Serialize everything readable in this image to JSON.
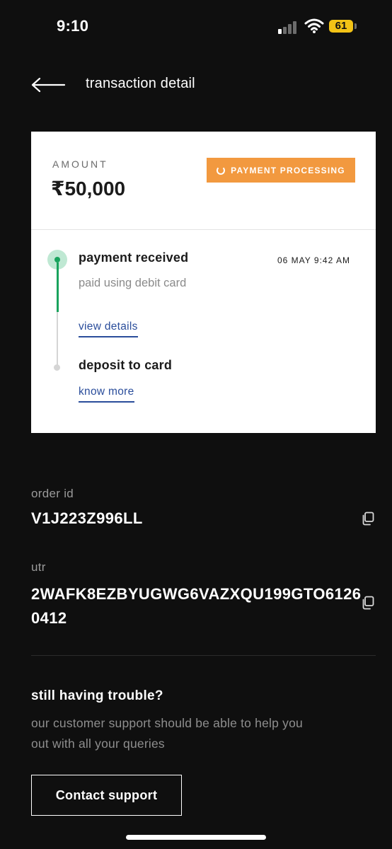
{
  "status_bar": {
    "time": "9:10",
    "battery": "61",
    "icons": [
      "signal-icon",
      "wifi-icon",
      "battery-icon"
    ]
  },
  "header": {
    "title": "transaction detail",
    "back_icon": "arrow-left-icon"
  },
  "card": {
    "amount_label": "AMOUNT",
    "amount_value": "₹50,000",
    "status_badge": "PAYMENT PROCESSING",
    "steps": [
      {
        "title": "payment received",
        "time": "06 MAY 9:42 AM",
        "subtitle": "paid using debit card",
        "link": "view details"
      },
      {
        "title": "deposit to card",
        "link": "know more"
      }
    ]
  },
  "details": {
    "order_label": "order id",
    "order_value": "V1J223Z996LL",
    "utr_label": "utr",
    "utr_value": "2WAFK8EZBYUGWG6VAZXQU199GTO61260412"
  },
  "support": {
    "title": "still having trouble?",
    "body": "our customer support should be able to help you out with all your queries",
    "button": "Contact support"
  },
  "colors": {
    "background": "#0f0f0f",
    "badge": "#f2993f",
    "success": "#19a35d",
    "link": "#2a4d9b",
    "battery": "#f3c316"
  }
}
